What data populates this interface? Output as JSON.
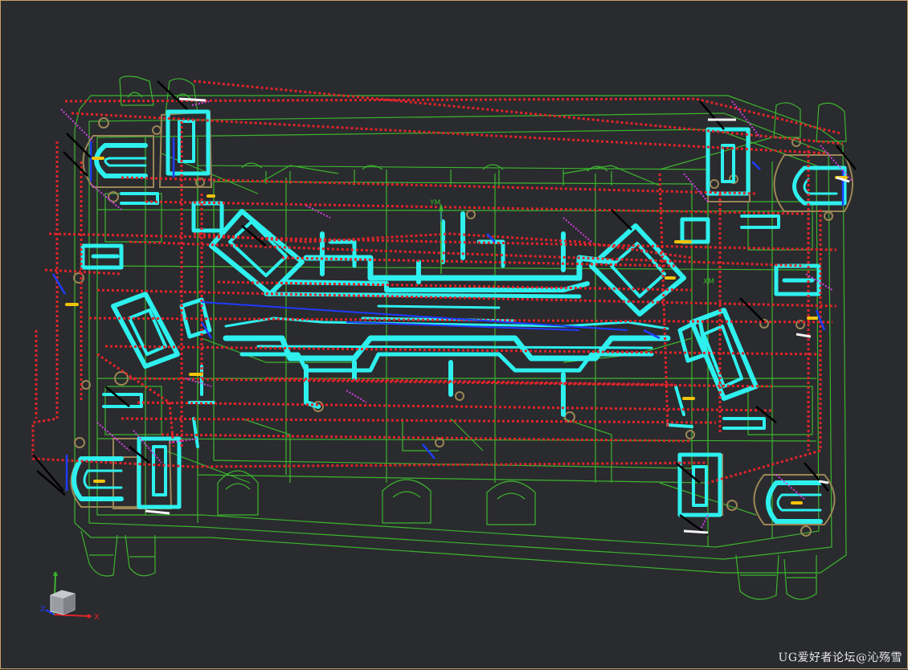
{
  "viewport": {
    "background": "#2a2b2e",
    "border_color": "#c8a06a"
  },
  "colors": {
    "outline": "#3bb52e",
    "channel": "#2ef0ee",
    "route": "#e0242a",
    "fitting": "#9a8656",
    "accent_blue": "#1e3cff",
    "accent_magenta": "#d040e0",
    "accent_yellow": "#f2c40c",
    "accent_black": "#000000"
  },
  "model_labels": {
    "ym": "YM",
    "xm": "XM"
  },
  "triad": {
    "x_label": "X",
    "y_label": "Y",
    "z_label": "Z",
    "cube_icon": "view-cube-icon"
  },
  "watermark": {
    "text": "UG爱好者论坛@沁殇雪"
  }
}
